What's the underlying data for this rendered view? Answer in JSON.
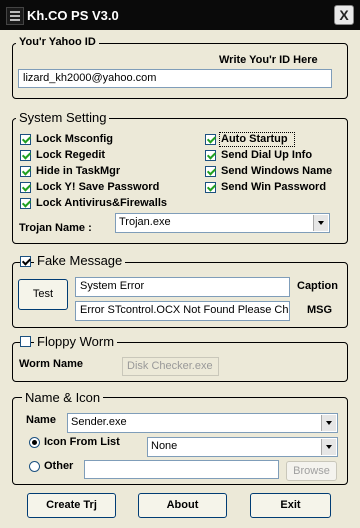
{
  "window": {
    "title": "Kh.CO PS V3.0",
    "close_glyph": "X"
  },
  "yahoo": {
    "legend": "You'r Yahoo ID",
    "hint": "Write You'r ID  Here",
    "value": "lizard_kh2000@yahoo.com"
  },
  "system": {
    "legend": "System Setting",
    "left_options": [
      {
        "label": "Lock Msconfig",
        "checked": true
      },
      {
        "label": "Lock Regedit",
        "checked": true
      },
      {
        "label": "Hide in TaskMgr",
        "checked": true
      },
      {
        "label": "Lock Y! Save Password",
        "checked": true
      },
      {
        "label": "Lock Antivirus&Firewalls",
        "checked": true
      }
    ],
    "right_options": [
      {
        "label": "Auto Startup",
        "checked": true
      },
      {
        "label": "Send Dial Up Info",
        "checked": true
      },
      {
        "label": "Send Windows Name",
        "checked": true
      },
      {
        "label": "Send Win Password",
        "checked": true
      }
    ],
    "trojan_label": "Trojan Name :",
    "trojan_value": "Trojan.exe"
  },
  "fake": {
    "legend": "Fake Message",
    "checked": true,
    "test_label": "Test",
    "caption_value": "System Error",
    "caption_label": "Caption",
    "msg_value": "Error STcontrol.OCX Not Found Please Chec",
    "msg_label": "MSG"
  },
  "floppy": {
    "legend": "Floppy Worm",
    "checked": false,
    "worm_label": "Worm Name",
    "worm_value": "Disk Checker.exe"
  },
  "nameicon": {
    "legend": "Name & Icon",
    "name_label": "Name",
    "name_value": "Sender.exe",
    "icon_list_label": "Icon From List",
    "icon_list_value": "None",
    "icon_list_selected": true,
    "other_label": "Other",
    "other_value": "",
    "browse_label": "Browse"
  },
  "buttons": {
    "create": "Create Trj",
    "about": "About",
    "exit": "Exit"
  }
}
